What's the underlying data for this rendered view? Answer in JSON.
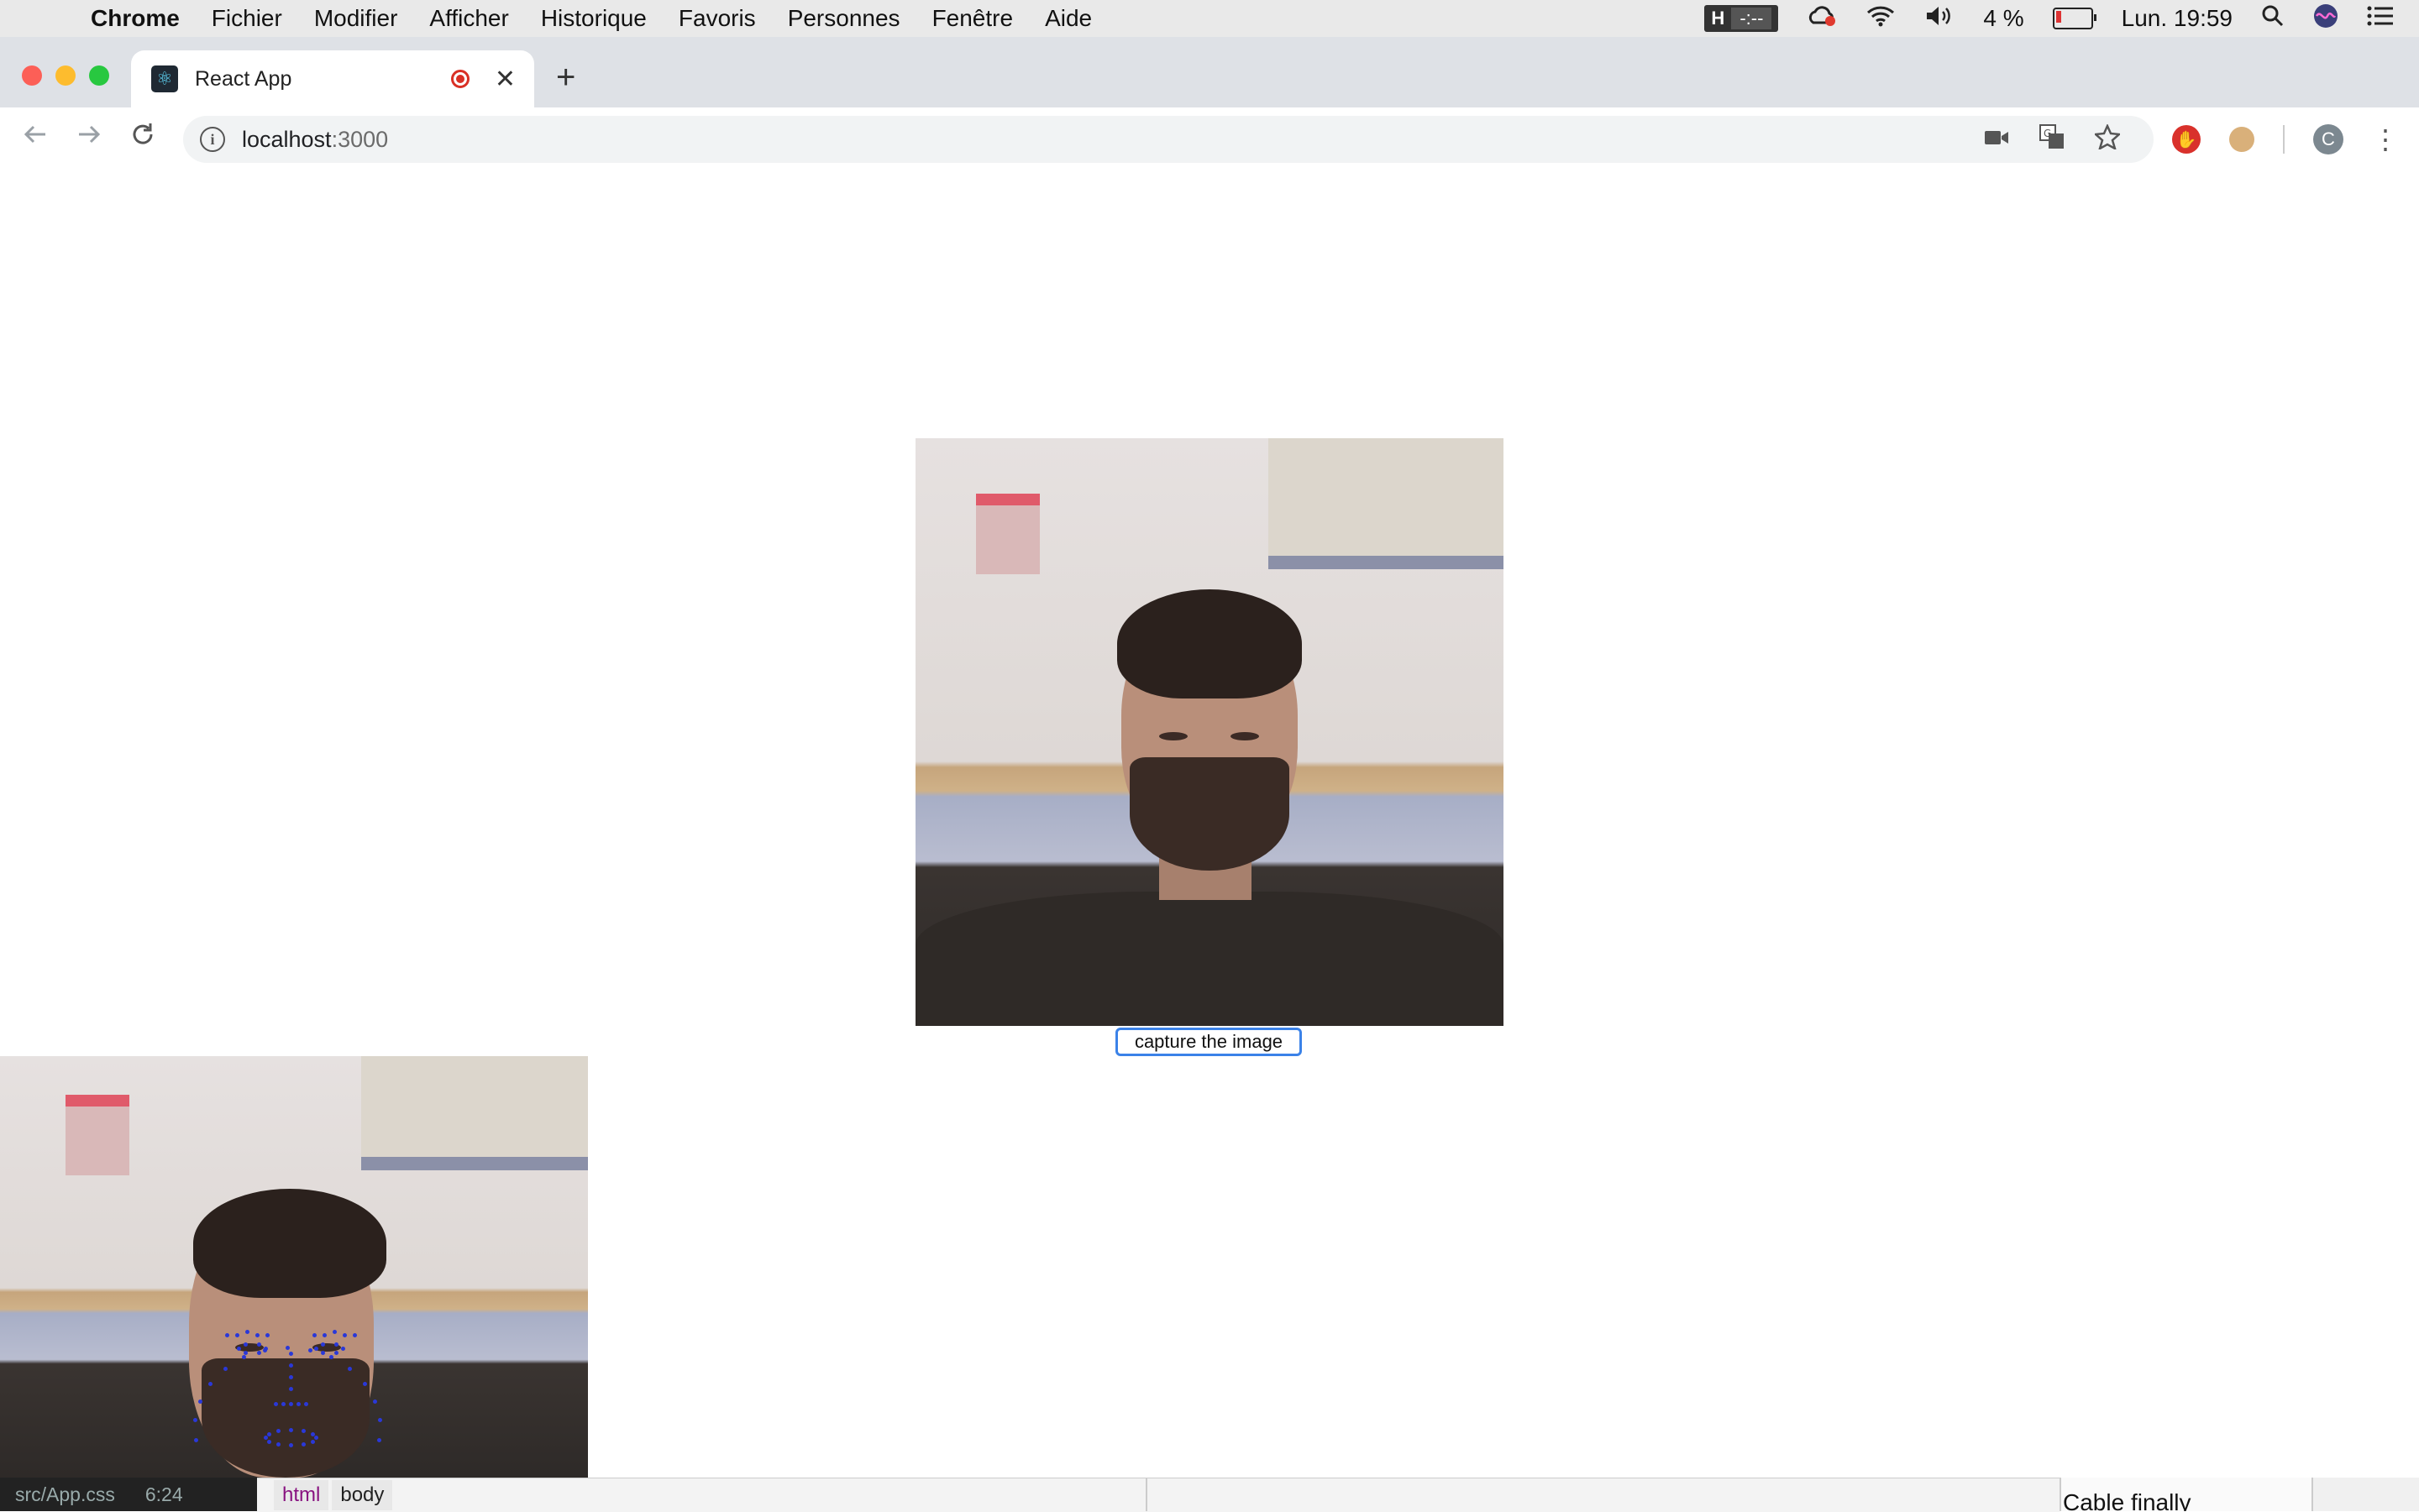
{
  "menubar": {
    "app_name": "Chrome",
    "items": [
      "Fichier",
      "Modifier",
      "Afficher",
      "Historique",
      "Favoris",
      "Personnes",
      "Fenêtre",
      "Aide"
    ],
    "status_h": "H",
    "status_timer": "-:--",
    "battery_percent": "4 %",
    "clock": "Lun. 19:59"
  },
  "browser": {
    "tab_title": "React App",
    "url_host": "localhost",
    "url_port": ":3000",
    "profile_initial": "C"
  },
  "page": {
    "capture_button_label": "capture the image",
    "landmark_color": "#2a38d8"
  },
  "bottom": {
    "editor_file": "src/App.css",
    "editor_position": "6:24",
    "breadcrumb_html": "html",
    "breadcrumb_body": "body",
    "other_window_text": "Cable finally"
  }
}
